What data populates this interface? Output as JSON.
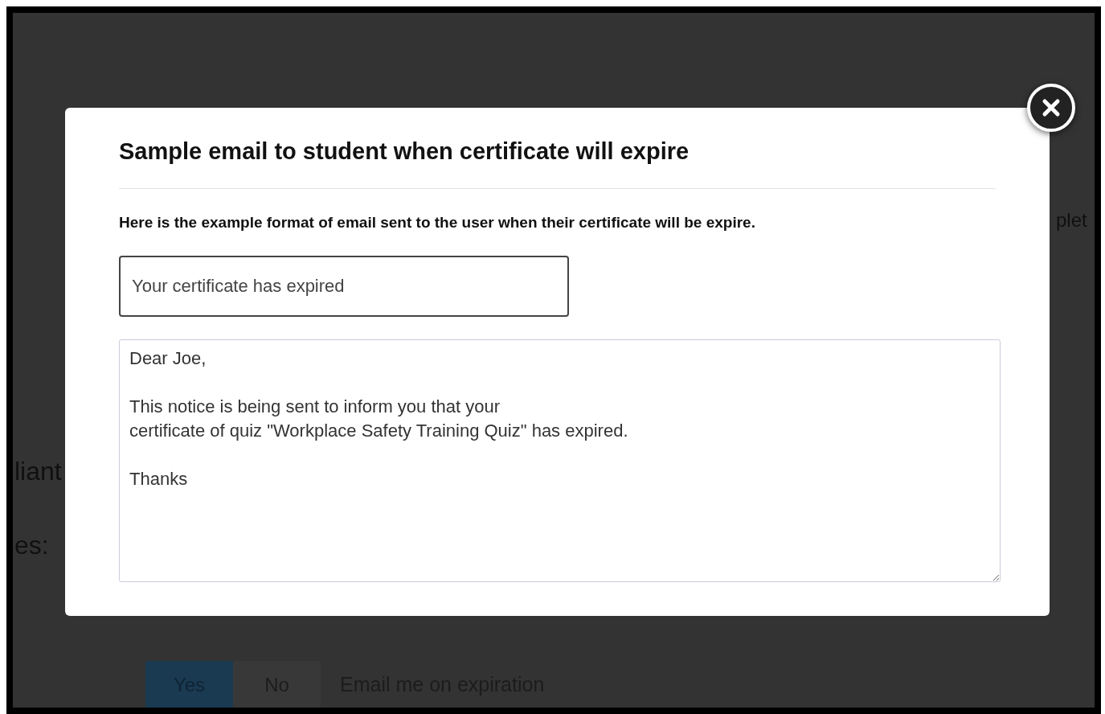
{
  "background": {
    "fragments": [
      {
        "kind": "heading-right",
        "text": "plet"
      },
      {
        "kind": "label-left",
        "text": "liant"
      },
      {
        "kind": "label-left-2",
        "text": "es:"
      }
    ],
    "toggle_rows": [
      {
        "label": "Email me on expiration",
        "options": [
          {
            "label": "Yes",
            "selected": true
          },
          {
            "label": "No",
            "selected": false
          }
        ]
      }
    ]
  },
  "modal": {
    "title": "Sample email to student when certificate will expire",
    "intro": "Here is the example format of email sent to the user when their certificate will be expire.",
    "subject": "Your certificate has expired",
    "body": "Dear Joe,\n\nThis notice is being sent to inform you that your\ncertificate of quiz \"Workplace Safety Training Quiz\" has expired.\n\nThanks"
  }
}
